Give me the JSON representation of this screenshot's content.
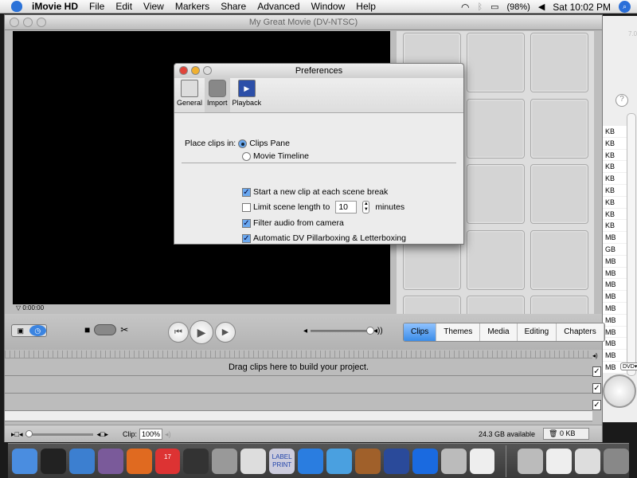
{
  "menubar": {
    "app": "iMovie HD",
    "items": [
      "File",
      "Edit",
      "View",
      "Markers",
      "Share",
      "Advanced",
      "Window",
      "Help"
    ],
    "battery": "(98%)",
    "clock": "Sat 10:02 PM"
  },
  "window": {
    "title": "My Great Movie (DV-NTSC)",
    "timecode": "0:00:00"
  },
  "background_window": {
    "version": "7.0",
    "sizes": [
      "KB",
      "KB",
      "KB",
      "KB",
      "KB",
      "KB",
      "KB",
      "KB",
      "KB",
      "MB",
      "GB",
      "MB",
      "MB",
      "MB",
      "MB",
      "MB",
      "MB",
      "MB",
      "MB",
      "MB",
      "MB"
    ],
    "help": "?",
    "dvd_label": "DVD▾"
  },
  "tabs": [
    "Clips",
    "Themes",
    "Media",
    "Editing",
    "Chapters"
  ],
  "active_tab": "Clips",
  "timeline": {
    "hint": "Drag clips here to build your project."
  },
  "status": {
    "clip_label": "Clip:",
    "clip_volume": "100%",
    "available": "24.3 GB available",
    "trash": "0 KB"
  },
  "preferences": {
    "title": "Preferences",
    "toolbar": [
      {
        "label": "General",
        "icon": "switch-icon"
      },
      {
        "label": "Import",
        "icon": "camcorder-icon"
      },
      {
        "label": "Playback",
        "icon": "playback-icon"
      }
    ],
    "selected_tab": "Import",
    "place_label": "Place clips in:",
    "place_options": [
      {
        "label": "Clips Pane",
        "selected": true
      },
      {
        "label": "Movie Timeline",
        "selected": false
      }
    ],
    "checks": [
      {
        "label": "Start a new clip at each scene break",
        "checked": true
      },
      {
        "label": "Limit scene length to",
        "checked": false
      },
      {
        "label": "Filter audio from camera",
        "checked": true
      },
      {
        "label": "Automatic DV Pillarboxing & Letterboxing",
        "checked": true
      }
    ],
    "scene_length": "10",
    "scene_unit": "minutes"
  },
  "dock": [
    {
      "name": "finder",
      "color": "#4a8de0"
    },
    {
      "name": "dashboard",
      "color": "#222"
    },
    {
      "name": "safari",
      "color": "#3c7fd0"
    },
    {
      "name": "tor",
      "color": "#7a5a9a"
    },
    {
      "name": "firefox",
      "color": "#e06a20"
    },
    {
      "name": "ical",
      "color": "#d33",
      "label": "17"
    },
    {
      "name": "disk-utility",
      "color": "#333"
    },
    {
      "name": "audio-app",
      "color": "#999"
    },
    {
      "name": "printer",
      "color": "#ddd"
    },
    {
      "name": "label-print",
      "color": "#ccd",
      "label": "LABEL PRINT"
    },
    {
      "name": "quicktime",
      "color": "#2a7de0"
    },
    {
      "name": "itunes",
      "color": "#4aa0e0"
    },
    {
      "name": "iphoto",
      "color": "#a0602a"
    },
    {
      "name": "imovie",
      "color": "#2a4a9a"
    },
    {
      "name": "iweb",
      "color": "#1a6ae0"
    },
    {
      "name": "system-prefs",
      "color": "#bbb"
    },
    {
      "name": "textedit",
      "color": "#eee"
    }
  ],
  "dock_right": [
    {
      "name": "drive",
      "color": "#bbb"
    },
    {
      "name": "document",
      "color": "#eee"
    },
    {
      "name": "window",
      "color": "#ddd"
    },
    {
      "name": "trash",
      "color": "#888"
    }
  ]
}
